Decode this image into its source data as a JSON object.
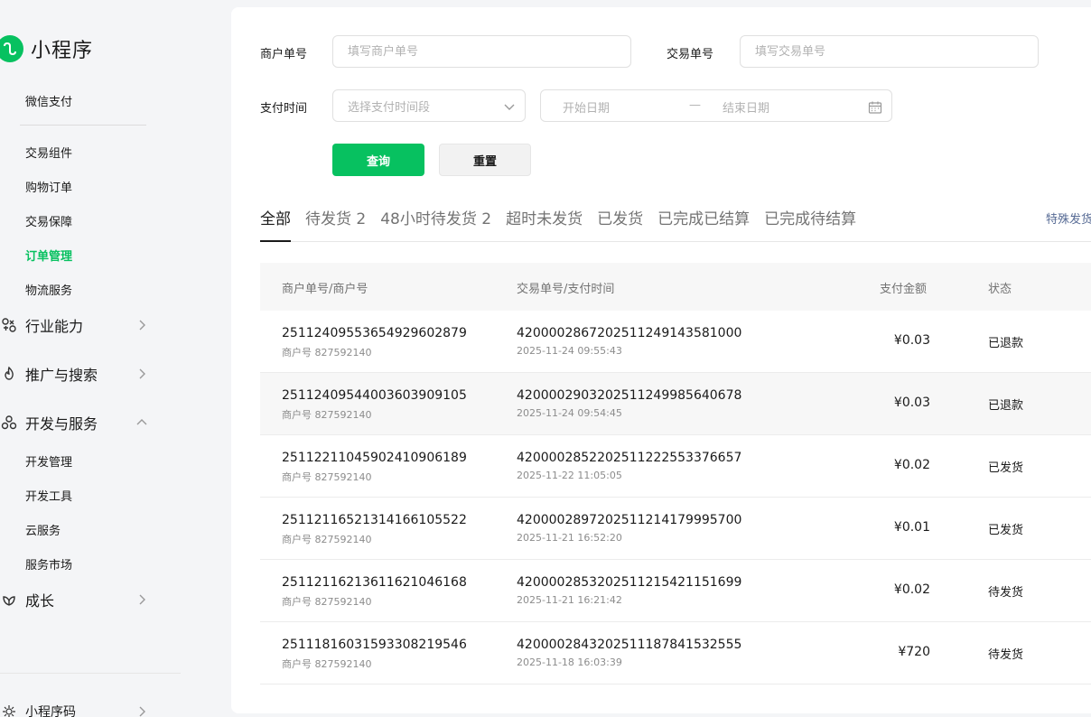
{
  "sidebar": {
    "brand_title": "小程序",
    "top_items": [
      {
        "label": "微信支付"
      }
    ],
    "sub_items": [
      {
        "label": "交易组件"
      },
      {
        "label": "购物订单"
      },
      {
        "label": "交易保障"
      },
      {
        "label": "订单管理",
        "active": true
      },
      {
        "label": "物流服务"
      }
    ],
    "groups": [
      {
        "label": "行业能力",
        "icon": "industry-icon",
        "expanded": false
      },
      {
        "label": "推广与搜索",
        "icon": "flame-icon",
        "expanded": false
      },
      {
        "label": "开发与服务",
        "icon": "dev-service-icon",
        "expanded": true
      },
      {
        "label": "成长",
        "icon": "growth-icon",
        "expanded": false
      }
    ],
    "dev_items": [
      {
        "label": "开发管理"
      },
      {
        "label": "开发工具"
      },
      {
        "label": "云服务"
      },
      {
        "label": "服务市场"
      }
    ],
    "bottom_item": {
      "label": "小程序码",
      "icon": "qrcode-icon"
    }
  },
  "filters": {
    "merchant_no_label": "商户单号",
    "merchant_no_placeholder": "填写商户单号",
    "trade_no_label": "交易单号",
    "trade_no_placeholder": "填写交易单号",
    "pay_time_label": "支付时间",
    "pay_time_select_placeholder": "选择支付时间段",
    "start_date_placeholder": "开始日期",
    "date_separator": "—",
    "end_date_placeholder": "结束日期",
    "query_button": "查询",
    "reset_button": "重置"
  },
  "tabs": {
    "items": [
      {
        "label": "全部",
        "active": true
      },
      {
        "label": "待发货 2"
      },
      {
        "label": "48小时待发货 2"
      },
      {
        "label": "超时未发货"
      },
      {
        "label": "已发货"
      },
      {
        "label": "已完成已结算"
      },
      {
        "label": "已完成待结算"
      }
    ],
    "special_link": "特殊发货"
  },
  "table": {
    "headers": {
      "merchant": "商户单号/商户号",
      "trade": "交易单号/支付时间",
      "amount": "支付金额",
      "status": "状态"
    },
    "rows": [
      {
        "merchant_order": "2511240955365492960287​9",
        "merchant_id": "商户号 827592140",
        "trade_no": "4200002867202511249143581000",
        "pay_time": "2025-11-24 09:55:43",
        "amount": "¥0.03",
        "status": "已退款"
      },
      {
        "merchant_order": "2511240954400360390910​5",
        "merchant_id": "商户号 827592140",
        "trade_no": "4200002903202511249985640678",
        "pay_time": "2025-11-24 09:54:45",
        "amount": "¥0.03",
        "status": "已退款"
      },
      {
        "merchant_order": "2511221104590241090618​9",
        "merchant_id": "商户号 827592140",
        "trade_no": "4200002852202511222553376657",
        "pay_time": "2025-11-22 11:05:05",
        "amount": "¥0.02",
        "status": "已发货"
      },
      {
        "merchant_order": "2511211652131416610552​2",
        "merchant_id": "商户号 827592140",
        "trade_no": "4200002897202511214179995700",
        "pay_time": "2025-11-21 16:52:20",
        "amount": "¥0.01",
        "status": "已发货"
      },
      {
        "merchant_order": "2511211621361162104616​8",
        "merchant_id": "商户号 827592140",
        "trade_no": "4200002853202511215421151699",
        "pay_time": "2025-11-21 16:21:42",
        "amount": "¥0.02",
        "status": "待发货"
      },
      {
        "merchant_order": "2511181603159330821954​6",
        "merchant_id": "商户号 827592140",
        "trade_no": "4200002843202511187841532555",
        "pay_time": "2025-11-18 16:03:39",
        "amount": "¥720",
        "status": "待发货"
      }
    ]
  },
  "colors": {
    "brand_green": "#07c160",
    "link_blue": "#576b95"
  }
}
